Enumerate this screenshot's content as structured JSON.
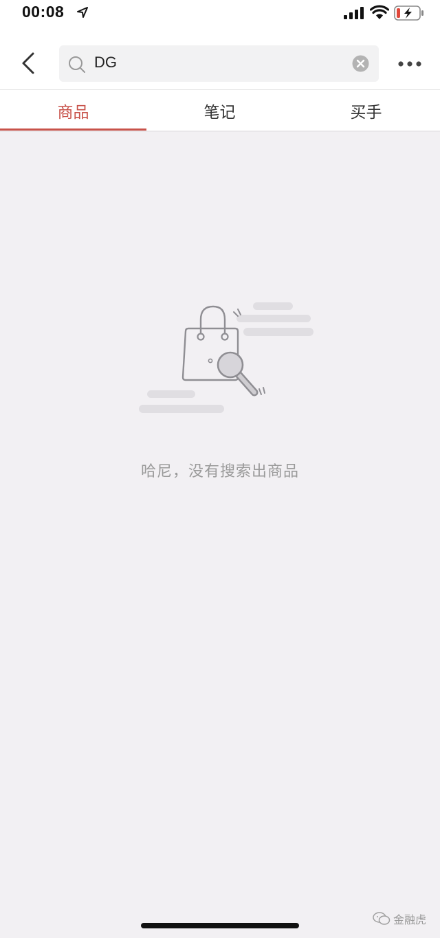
{
  "status_bar": {
    "time": "00:08"
  },
  "search": {
    "query": "DG"
  },
  "tabs": [
    {
      "label": "商品",
      "active": true
    },
    {
      "label": "笔记",
      "active": false
    },
    {
      "label": "买手",
      "active": false
    }
  ],
  "empty_state": {
    "message": "哈尼，没有搜索出商品"
  },
  "watermark": {
    "text": "金融虎"
  },
  "colors": {
    "accent": "#c8524a",
    "page_background": "#f2f0f3",
    "muted_text": "#9a9a9a"
  }
}
